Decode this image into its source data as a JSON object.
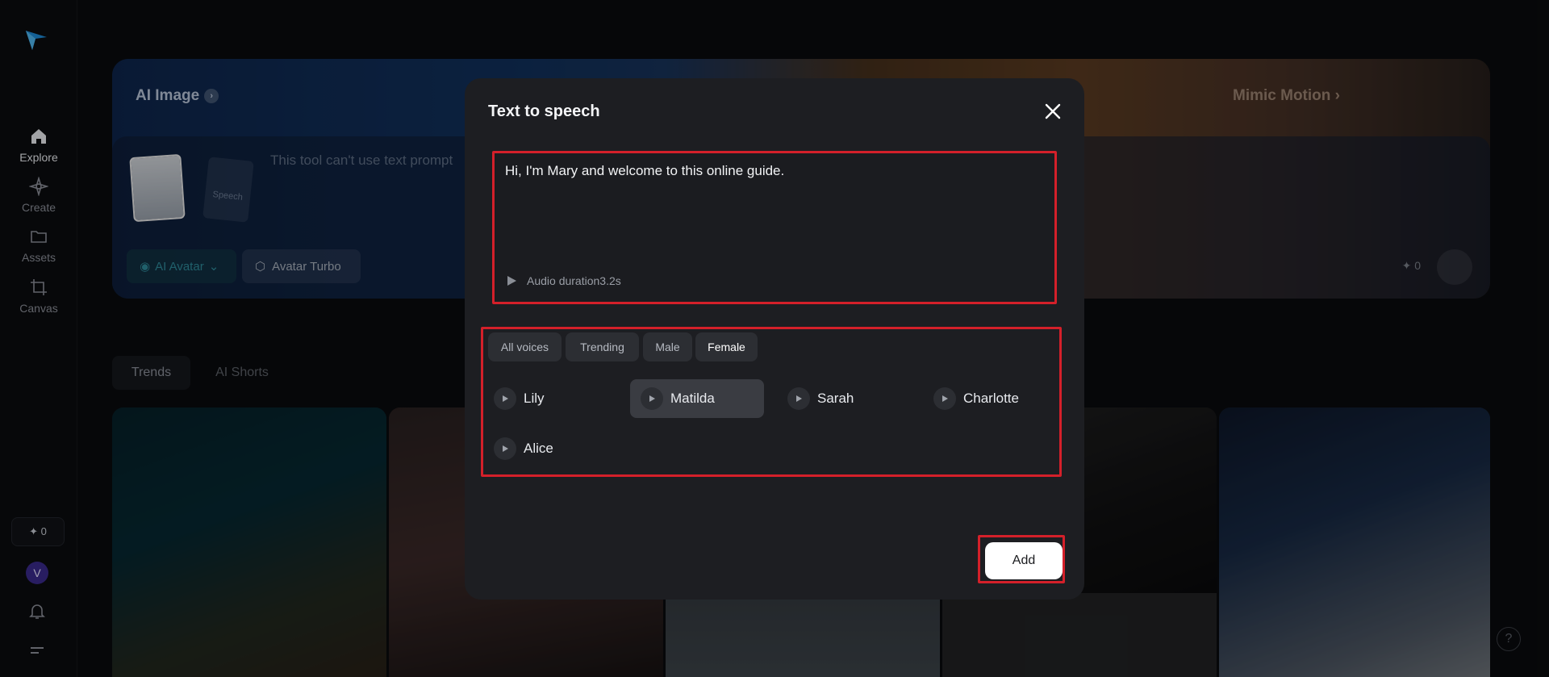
{
  "sidebar": {
    "items": [
      {
        "label": "Explore",
        "icon": "home-icon"
      },
      {
        "label": "Create",
        "icon": "sparkle-icon"
      },
      {
        "label": "Assets",
        "icon": "folder-icon"
      },
      {
        "label": "Canvas",
        "icon": "crop-icon"
      }
    ],
    "credits": "✦ 0",
    "avatar_initial": "V"
  },
  "hero": {
    "title": "AI Image",
    "right_title": "Mimic Motion",
    "placeholder": "This tool can't use text prompt",
    "speech_label": "Speech",
    "mode_chip": "AI Avatar",
    "turbo_chip": "Avatar Turbo",
    "count": "✦ 0"
  },
  "tabs": [
    "Trends",
    "AI Shorts"
  ],
  "modal": {
    "title": "Text to speech",
    "text_value": "Hi, I'm Mary and welcome to this online guide.",
    "audio_label": "Audio duration3.2s",
    "filters": [
      "All voices",
      "Trending",
      "Male",
      "Female"
    ],
    "active_filter": "Female",
    "voices": [
      "Lily",
      "Matilda",
      "Sarah",
      "Charlotte",
      "Alice"
    ],
    "selected_voice": "Matilda",
    "add_label": "Add"
  },
  "colors": {
    "highlight": "#d4202a",
    "modal_bg": "#1d1e22",
    "page_bg": "#0a0b0d"
  }
}
